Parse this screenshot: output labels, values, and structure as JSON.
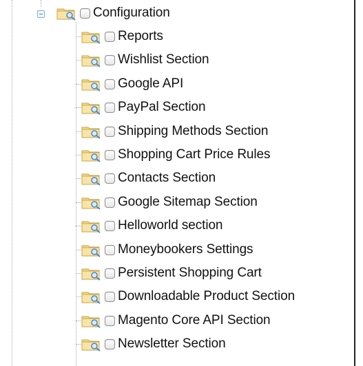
{
  "tree": {
    "parent": {
      "label": "Configuration",
      "expanded": true
    },
    "children": [
      {
        "label": "Reports"
      },
      {
        "label": "Wishlist Section"
      },
      {
        "label": "Google API"
      },
      {
        "label": "PayPal Section"
      },
      {
        "label": "Shipping Methods Section"
      },
      {
        "label": "Shopping Cart Price Rules"
      },
      {
        "label": "Contacts Section"
      },
      {
        "label": "Google Sitemap Section"
      },
      {
        "label": "Helloworld section"
      },
      {
        "label": "Moneybookers Settings"
      },
      {
        "label": "Persistent Shopping Cart"
      },
      {
        "label": "Downloadable Product Section"
      },
      {
        "label": "Magento Core API Section"
      },
      {
        "label": "Newsletter Section"
      }
    ]
  },
  "colors": {
    "folder_body": "#f5d986",
    "folder_edge": "#c9a54a",
    "magnifier": "#4f86c6",
    "tree_line": "#a8a8a8",
    "frame_border": "#222222"
  },
  "icons": {
    "toggle": "collapse-minus-icon",
    "node": "folder-search-icon"
  }
}
